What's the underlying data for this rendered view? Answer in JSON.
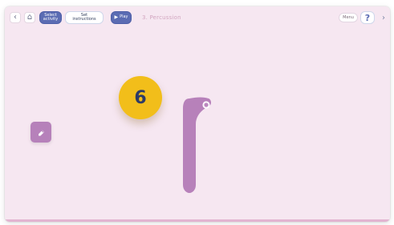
{
  "topbar": {
    "back_icon": "chevron-left-icon",
    "home_icon": "home-icon",
    "buttons": {
      "select_activity": "Select\nactivity",
      "secondary": "Set instructions",
      "play": "Play"
    },
    "activity_title": "3. Percussion",
    "right": {
      "pill_label": "Menu",
      "help_label": "?",
      "next_icon": "chevron-right-icon"
    }
  },
  "canvas": {
    "step_number": "6",
    "side_tool_icon": "eraser-icon"
  },
  "colors": {
    "background": "#f6e7f1",
    "primary": "#5b6cb3",
    "badge": "#f2be1a",
    "shape": "#b781ba"
  }
}
